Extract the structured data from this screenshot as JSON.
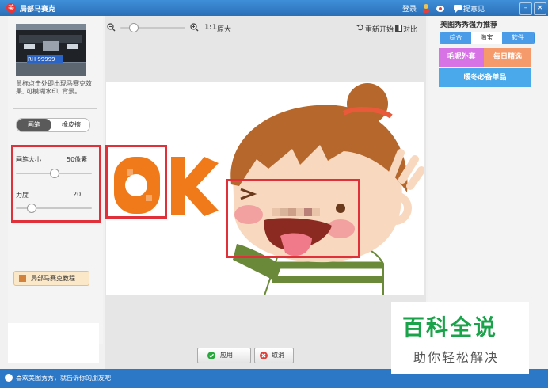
{
  "window": {
    "title": "局部马赛克",
    "login": "登录",
    "feedback": "提意见",
    "colors": {
      "titlebar": "#2f7ac8",
      "annotation": "#e0313a",
      "orange": "#f07a1a"
    }
  },
  "left_panel": {
    "hint": "鼠标点击处即出现马赛克效果, 可模糊水印, 背景。",
    "license_plate": "RH 99999",
    "toggle": {
      "active": "画笔",
      "inactive": "橡皮擦"
    },
    "brush_size": {
      "label": "画笔大小",
      "value": "50像素",
      "level": 0.5
    },
    "strength": {
      "label": "力度",
      "value": "20",
      "level": 0.2
    },
    "tutorial": "局部马赛克教程"
  },
  "toolbar": {
    "zoom_level": 0.2,
    "ratio": "1:1",
    "original_size": "原大",
    "reset": "重新开始",
    "compare": "对比"
  },
  "canvas": {
    "ok_text": "OK"
  },
  "buttons": {
    "apply": "应用",
    "cancel": "取消"
  },
  "right_panel": {
    "title": "美图秀秀强力推荐",
    "tabs": [
      {
        "label": "综合",
        "active": false
      },
      {
        "label": "淘宝",
        "active": true
      },
      {
        "label": "软件",
        "active": false
      }
    ],
    "promos": [
      {
        "label": "毛呢外套",
        "color": "#d873e6"
      },
      {
        "label": "每日精选",
        "color": "#f59a6b"
      },
      {
        "label": "暖冬必备单品",
        "color": "#49a9ea"
      }
    ]
  },
  "status_bar": {
    "text": "喜欢美图秀秀，就告诉你的朋友吧!"
  },
  "watermark": {
    "main": "百科全说",
    "sub": "助你轻松解决"
  }
}
